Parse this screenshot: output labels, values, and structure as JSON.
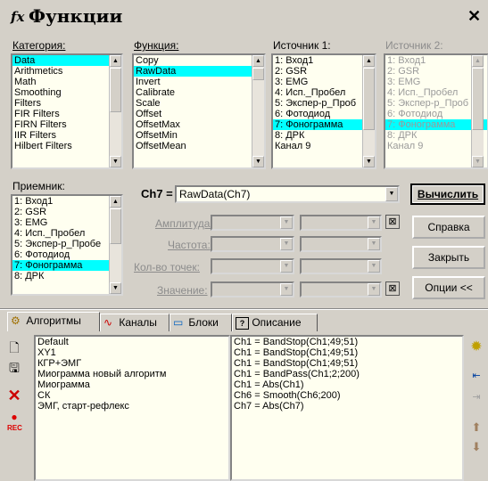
{
  "window": {
    "icon_text": "fx",
    "title": "Функции",
    "close_label": "✕"
  },
  "category": {
    "label": "Категория:",
    "items": [
      "Data",
      "Arithmetics",
      "Math",
      "Smoothing",
      "Filters",
      "FIR Filters",
      "FIRN Filters",
      "IIR Filters",
      "Hilbert Filters"
    ],
    "selected": 0
  },
  "function": {
    "label": "Функция:",
    "items": [
      "Copy",
      "RawData",
      "Invert",
      "Calibrate",
      "Scale",
      "Offset",
      "OffsetMax",
      "OffsetMin",
      "OffsetMean"
    ],
    "selected": 1
  },
  "source1": {
    "label": "Источник 1:",
    "items": [
      "1: Вход1",
      "2: GSR",
      "3: EMG",
      "4: Исп._Пробел",
      "5: Экспер-р_Проб",
      "6: Фотодиод",
      "7: Фонограмма",
      "8: ДРК",
      "Канал 9"
    ],
    "selected": 6
  },
  "source2": {
    "label": "Источник 2:",
    "items": [
      "1: Вход1",
      "2: GSR",
      "3: EMG",
      "4: Исп._Пробел",
      "5: Экспер-р_Проб",
      "6: Фотодиод",
      "7: Фонограмма",
      "8: ДРК",
      "Канал 9"
    ],
    "selected": 6
  },
  "receiver": {
    "label": "Приемник:",
    "items": [
      "1: Вход1",
      "2: GSR",
      "3: EMG",
      "4: Исп._Пробел",
      "5: Экспер-р_Пробе",
      "6: Фотодиод",
      "7: Фонограмма",
      "8: ДРК"
    ],
    "selected": 6
  },
  "formula": {
    "prefix": "Ch7 =",
    "value": "RawData(Ch7)"
  },
  "params": {
    "amplitude": "Амплитуда:",
    "frequency": "Частота:",
    "points": "Кол-во точек:",
    "value": "Значение:"
  },
  "buttons": {
    "calculate": "Вычислить",
    "help": "Справка",
    "close": "Закрыть",
    "options": "Опции <<"
  },
  "tabs": [
    {
      "label": "Алгоритмы"
    },
    {
      "label": "Каналы"
    },
    {
      "label": "Блоки"
    },
    {
      "label": "Описание"
    }
  ],
  "algorithms": {
    "items": [
      "Default",
      "XY1",
      "КГР+ЭМГ",
      "Миограмма новый алгоритм",
      "Миограмма",
      "СК",
      "ЭМГ, старт-рефлекс"
    ],
    "selected": 6
  },
  "algorithm_code": {
    "lines": [
      "Ch1 = BandStop(Ch1;49;51)",
      "Ch1 = BandStop(Ch1;49;51)",
      "Ch1 = BandStop(Ch1;49;51)",
      "Ch1 = BandPass(Ch1;2;200)",
      "Ch1 = Abs(Ch1)",
      "Ch6 = Smooth(Ch6;200)",
      "Ch7 = Abs(Ch7)"
    ]
  },
  "left_toolbar": {
    "rec_label": "REC"
  },
  "colors": {
    "selection": "#00ffff",
    "list_bg": "#fffff0",
    "window_bg": "#d4d0c8"
  }
}
